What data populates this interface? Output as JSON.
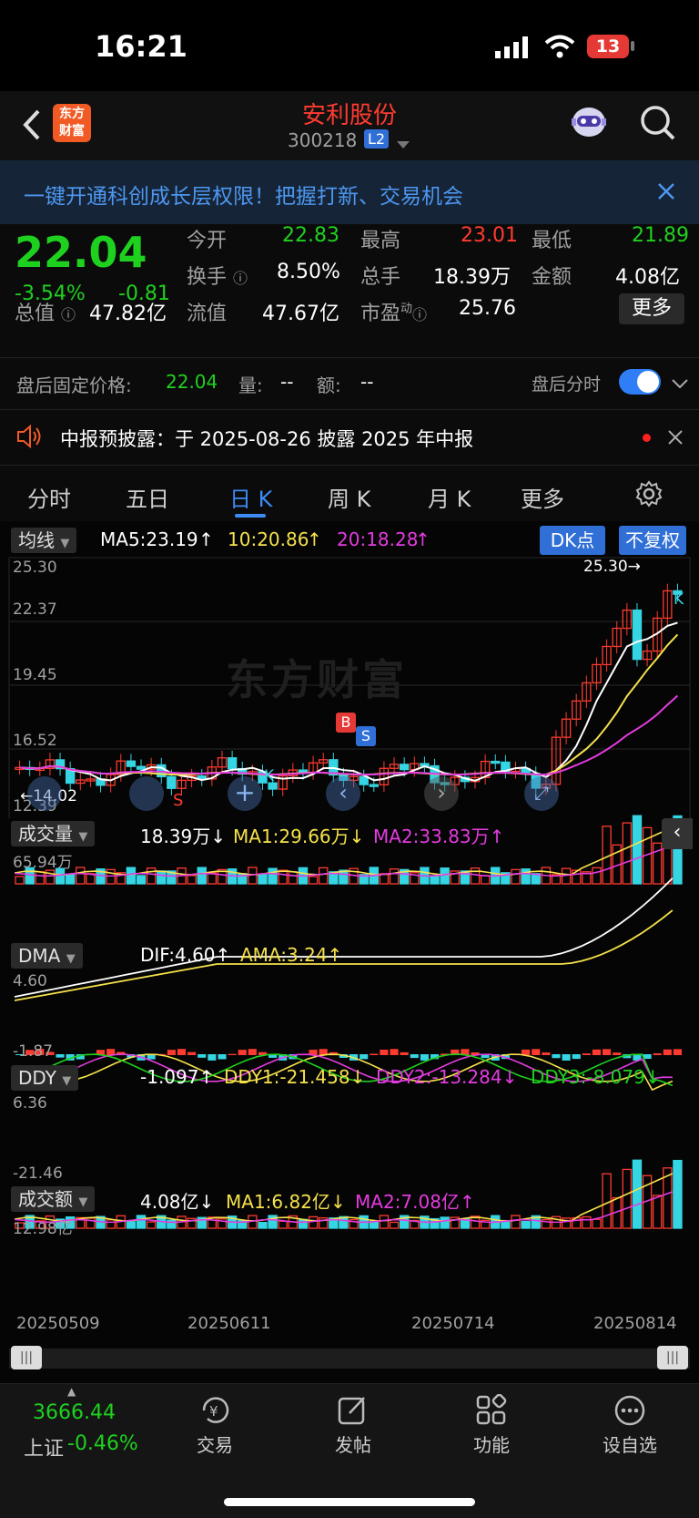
{
  "status": {
    "time": "16:21",
    "battery": "13"
  },
  "header": {
    "name": "安利股份",
    "code": "300218",
    "level": "L2",
    "logo_line1": "东方",
    "logo_line2": "财富"
  },
  "banner": {
    "text": "一键开通科创成长层权限！把握打新、交易机会"
  },
  "quote": {
    "price": "22.04",
    "pct": "-3.54%",
    "chg": "-0.81",
    "open_label": "今开",
    "open": "22.83",
    "high_label": "最高",
    "high": "23.01",
    "low_label": "最低",
    "low": "21.89",
    "turnover_label": "换手",
    "turnover": "8.50%",
    "vol_label": "总手",
    "vol": "18.39万",
    "amt_label": "金额",
    "amt": "4.08亿",
    "mcap_label": "总值",
    "mcap": "47.82亿",
    "float_label": "流值",
    "float": "47.67亿",
    "pe_label": "市盈",
    "pe_sup": "动",
    "pe": "25.76",
    "more": "更多"
  },
  "afterhours": {
    "label": "盘后固定价格:",
    "price": "22.04",
    "vol_label": "量:",
    "vol": "--",
    "amt_label": "额:",
    "amt": "--",
    "toggle_label": "盘后分时",
    "toggle_on": true
  },
  "notice": {
    "text": "中报预披露：于 2025-08-26 披露 2025 年中报"
  },
  "tabs": [
    "分时",
    "五日",
    "日 K",
    "周 K",
    "月 K",
    "更多"
  ],
  "active_tab": 2,
  "ma": {
    "label": "均线",
    "ma5": "MA5:23.19",
    "ma10": "10:20.86",
    "ma20": "20:18.28",
    "dk": "DK点",
    "fq": "不复权"
  },
  "price_axis": [
    "25.30",
    "22.37",
    "19.45",
    "16.52",
    "12.39"
  ],
  "price_marks": {
    "high": "25.30→",
    "low": "←14.02",
    "b": "B",
    "s": "S",
    "k": "K"
  },
  "watermark": "东方财富",
  "volume": {
    "label": "成交量",
    "val": "18.39万",
    "ma1": "MA1:29.66万",
    "ma2": "MA2:33.83万",
    "max": "65.94万"
  },
  "dma": {
    "label": "DMA",
    "dif": "DIF:4.60",
    "ama": "AMA:3.24",
    "max": "4.60",
    "min": "-1.87"
  },
  "ddy": {
    "label": "DDY",
    "val": "-1.097",
    "ddy1": "DDY1:-21.458",
    "ddy2": "DDY2:-13.284",
    "ddy3": "DDY3:-8.079",
    "max": "6.36",
    "min": "-21.46"
  },
  "amount": {
    "label": "成交额",
    "val": "4.08亿",
    "ma1": "MA1:6.82亿",
    "ma2": "MA2:7.08亿",
    "max": "12.98亿"
  },
  "dates": [
    "20250509",
    "20250611",
    "20250714",
    "20250814"
  ],
  "bottom": {
    "index_val": "3666.44",
    "index_name": "上证",
    "index_pct": "-0.46%",
    "nav": [
      "交易",
      "发帖",
      "功能",
      "设自选"
    ]
  },
  "colors": {
    "up": "#ff3b30",
    "down": "#35d5e3",
    "ma5": "#ffffff",
    "ma10": "#f5e14b",
    "ma20": "#e43be0",
    "accent": "#2f7ef5"
  }
}
